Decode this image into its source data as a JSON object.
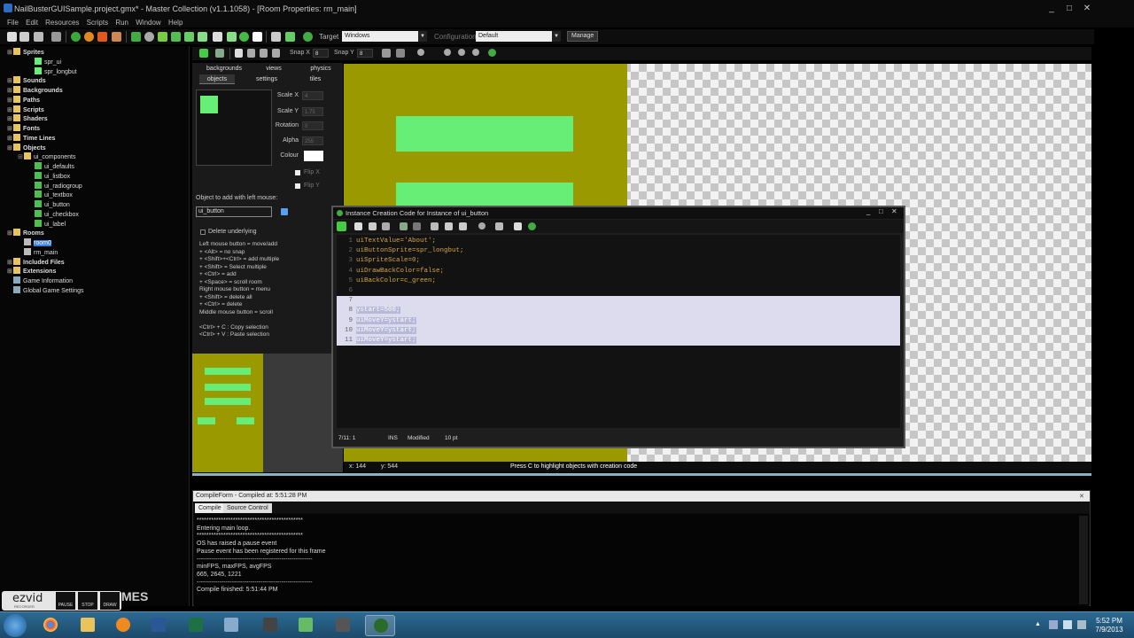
{
  "window": {
    "title": "NailBusterGUISample.project.gmx* - Master Collection (v1.1.1058) - [Room Properties: rm_main]",
    "controls": [
      "_",
      "□",
      "✕"
    ]
  },
  "menu": [
    "File",
    "Edit",
    "Resources",
    "Scripts",
    "Run",
    "Window",
    "Help"
  ],
  "toolbar": {
    "snap_x_label": "Snap X",
    "snap_x_value": "8",
    "snap_y_label": "Snap Y",
    "snap_y_value": "8",
    "target_label": "Target",
    "target_value": "Windows",
    "config_label": "Configuration",
    "config_value": "Default",
    "manage_label": "Manage"
  },
  "tree": [
    {
      "label": "Sprites",
      "bold": true,
      "icon": "folder"
    },
    {
      "label": "spr_ui",
      "bold": false,
      "icon": "sprite"
    },
    {
      "label": "spr_longbut",
      "bold": false,
      "icon": "sprite"
    },
    {
      "label": "Sounds",
      "bold": true,
      "icon": "folder"
    },
    {
      "label": "Backgrounds",
      "bold": true,
      "icon": "folder"
    },
    {
      "label": "Paths",
      "bold": true,
      "icon": "folder"
    },
    {
      "label": "Scripts",
      "bold": true,
      "icon": "folder"
    },
    {
      "label": "Shaders",
      "bold": true,
      "icon": "folder"
    },
    {
      "label": "Fonts",
      "bold": true,
      "icon": "folder"
    },
    {
      "label": "Time Lines",
      "bold": true,
      "icon": "folder"
    },
    {
      "label": "Objects",
      "bold": true,
      "icon": "folder"
    },
    {
      "label": "ui_components",
      "bold": false,
      "icon": "folder"
    },
    {
      "label": "ui_defaults",
      "bold": false,
      "icon": "object"
    },
    {
      "label": "ui_listbox",
      "bold": false,
      "icon": "object"
    },
    {
      "label": "ui_radiogroup",
      "bold": false,
      "icon": "object"
    },
    {
      "label": "ui_textbox",
      "bold": false,
      "icon": "object"
    },
    {
      "label": "ui_button",
      "bold": false,
      "icon": "object"
    },
    {
      "label": "ui_checkbox",
      "bold": false,
      "icon": "object"
    },
    {
      "label": "ui_label",
      "bold": false,
      "icon": "object"
    },
    {
      "label": "Rooms",
      "bold": true,
      "icon": "folder"
    },
    {
      "label": "room0",
      "bold": false,
      "icon": "room"
    },
    {
      "label": "rm_main",
      "bold": false,
      "icon": "room"
    },
    {
      "label": "Included Files",
      "bold": true,
      "icon": "folder"
    },
    {
      "label": "Extensions",
      "bold": true,
      "icon": "folder"
    },
    {
      "label": "Game Information",
      "bold": false,
      "icon": "info"
    },
    {
      "label": "Global Game Settings",
      "bold": false,
      "icon": "settings"
    }
  ],
  "room_props": {
    "tabs_top": [
      "backgrounds",
      "views",
      "physics"
    ],
    "tabs_bottom": [
      "objects",
      "settings",
      "tiles"
    ],
    "scale_x_label": "Scale X",
    "scale_x": "4",
    "scale_y_label": "Scale Y",
    "scale_y": "1.75",
    "rotation_label": "Rotation",
    "rotation": "0",
    "alpha_label": "Alpha",
    "alpha": "255",
    "colour_label": "Colour",
    "flip_x_label": "Flip X",
    "flip_y_label": "Flip Y",
    "object_add_label": "Object to add with left mouse:",
    "object_add_value": "ui_button",
    "delete_underlying_label": "Delete underlying",
    "help_lines": [
      "Left mouse button = move/add",
      "  + <Alt> = no snap",
      "  + <Shift>+<Ctrl> = add multiple",
      "  + <Shift> = Select multiple",
      "  + <Ctrl> = add",
      "  + <Space> = scroll room",
      "Right mouse button = menu",
      "  + <Shift> = delete all",
      "  + <Ctrl> = delete",
      "Middle mouse button = scroll",
      "",
      "<Ctrl> + C : Copy selection",
      "<Ctrl> + V : Paste selection"
    ]
  },
  "room_status": {
    "x": "x: 144",
    "y": "y: 544",
    "hint": "Press C to highlight objects with creation code"
  },
  "code_window": {
    "title": "Instance Creation Code for Instance of ui_button",
    "lines": [
      "uiTextValue='About';",
      "uiButtonSprite=spr_longbut;",
      "uiSpriteScale=0;",
      "uiDrawBackColor=false;",
      "uiBackColor=c_green;",
      "",
      "",
      "ystart=500;",
      "uiMoveY=ystart;",
      "uiMoveY=ystart;",
      "uiMoveY=ystart;"
    ],
    "status_pos": "7/11: 1",
    "status_mode": "INS",
    "status_modified": "Modified",
    "status_font": "10 pt"
  },
  "compile": {
    "header": "CompileForm - Compiled at: 5:51:28 PM",
    "tabs": [
      "Compile",
      "Source Control"
    ],
    "log": [
      "********************************************",
      "Entering main loop.",
      "********************************************",
      "OS has raised a pause event",
      "Pause event has been registered for this frame",
      "--------------------------------------------------------",
      "minFPS, maxFPS, avgFPS",
      "665, 2645, 1221",
      "--------------------------------------------------------",
      "Compile finished: 5:51:44 PM"
    ]
  },
  "recorder": {
    "logo": "ezvid",
    "sub": "RECORDER",
    "pause": "PAUSE",
    "stop": "STOP",
    "draw": "DRAW",
    "behind_text": "MES"
  },
  "taskbar": {
    "time": "5:52 PM",
    "date": "7/9/2013"
  },
  "colors": {
    "room_bg": "#9a9a00",
    "button_green": "#66ee77",
    "code_text": "#d6a640"
  }
}
